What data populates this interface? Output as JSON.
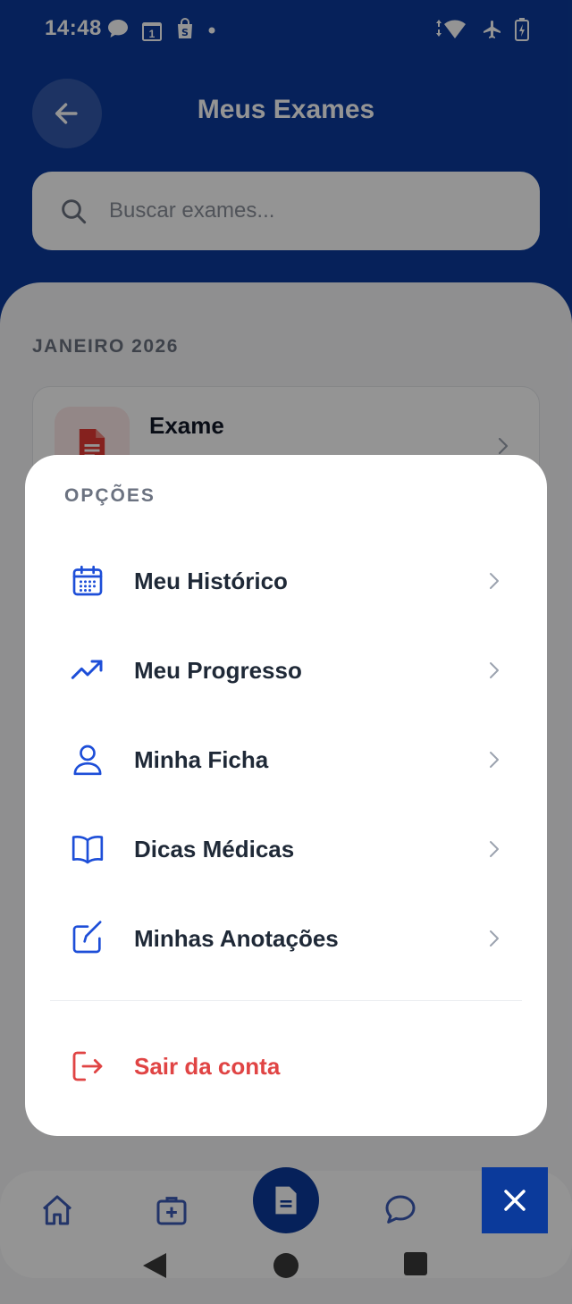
{
  "status_bar": {
    "time": "14:48",
    "calendar_badge": "1"
  },
  "header": {
    "title": "Meus Exames",
    "search_placeholder": "Buscar exames..."
  },
  "content": {
    "month_label": "JANEIRO 2026",
    "exams": [
      {
        "title": "Exame"
      }
    ]
  },
  "options_menu": {
    "title": "OPÇÕES",
    "items": [
      {
        "label": "Meu Histórico",
        "icon": "calendar-icon"
      },
      {
        "label": "Meu Progresso",
        "icon": "trending-up-icon"
      },
      {
        "label": "Minha Ficha",
        "icon": "user-icon"
      },
      {
        "label": "Dicas Médicas",
        "icon": "book-icon"
      },
      {
        "label": "Minhas Anotações",
        "icon": "edit-note-icon"
      }
    ],
    "logout_label": "Sair da conta"
  },
  "colors": {
    "primary": "#0b3a9b",
    "accent_icon": "#1d4ed8",
    "danger": "#e04444"
  }
}
